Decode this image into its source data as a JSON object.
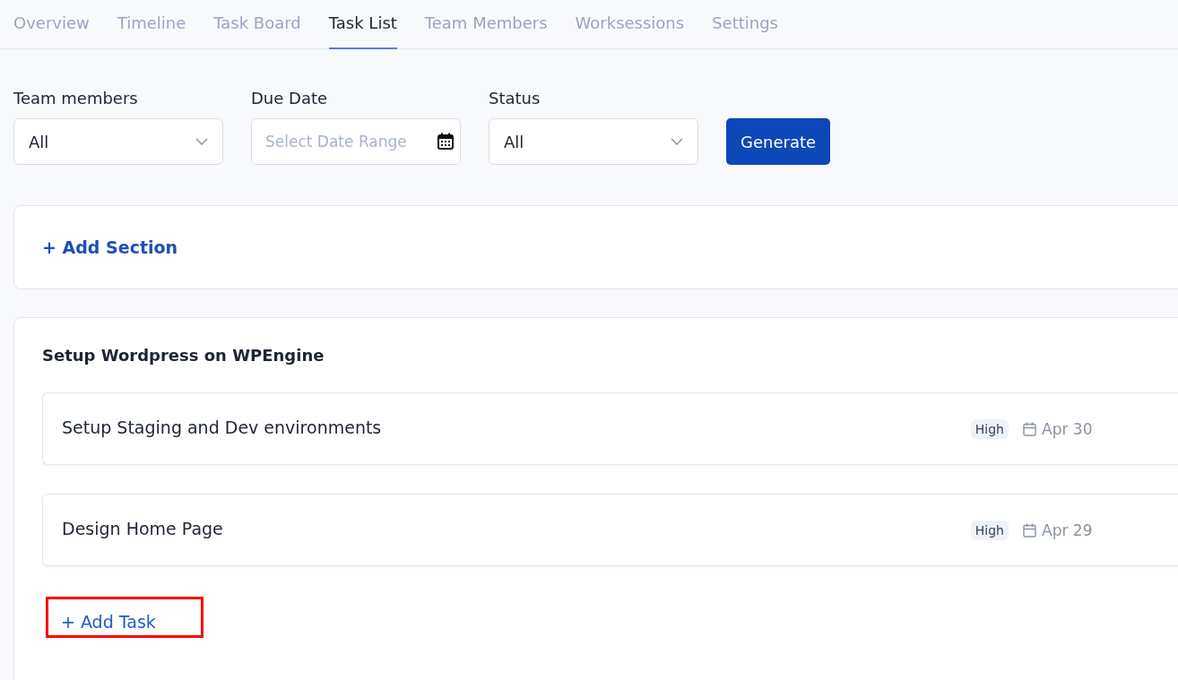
{
  "tabs": [
    {
      "label": "Overview",
      "selected": false
    },
    {
      "label": "Timeline",
      "selected": false
    },
    {
      "label": "Task Board",
      "selected": false
    },
    {
      "label": "Task List",
      "selected": true
    },
    {
      "label": "Team Members",
      "selected": false
    },
    {
      "label": "Worksessions",
      "selected": false
    },
    {
      "label": "Settings",
      "selected": false
    }
  ],
  "filters": [
    {
      "kind": "select",
      "label": "Team members",
      "value": "All"
    },
    {
      "kind": "date",
      "label": "Due Date",
      "placeholder": "Select Date Range"
    },
    {
      "kind": "select",
      "label": "Status",
      "value": "All"
    }
  ],
  "generate_button": "Generate",
  "add_section": "+ Add Section",
  "section": {
    "title": "Setup Wordpress on WPEngine",
    "tasks": [
      {
        "title": "Setup Staging and Dev environments",
        "priority": "High",
        "due": "Apr 30"
      },
      {
        "title": "Design Home Page",
        "priority": "High",
        "due": "Apr 29"
      }
    ],
    "add_task": {
      "label": "+ Add Task",
      "highlighted": true
    }
  }
}
